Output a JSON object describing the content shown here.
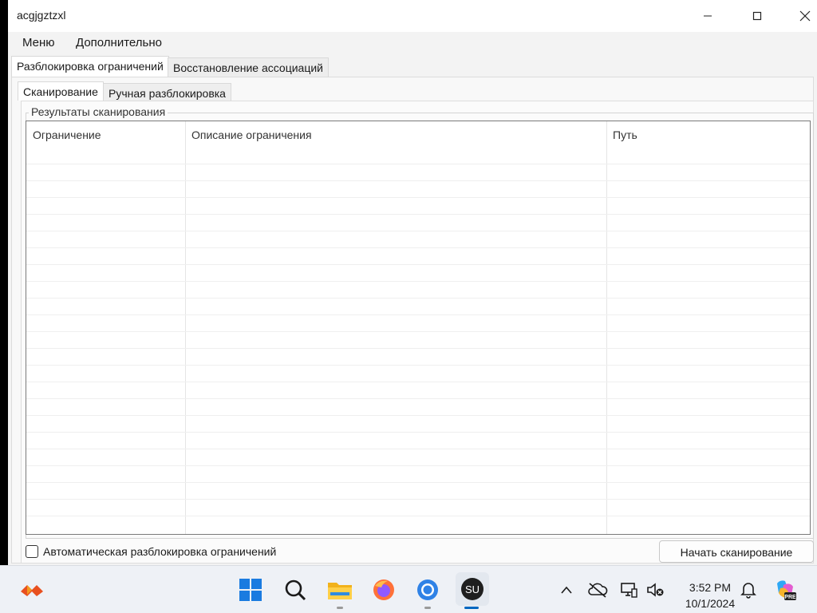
{
  "window": {
    "title": "acgjgztzxl"
  },
  "menu": {
    "items": [
      "Меню",
      "Дополнительно"
    ]
  },
  "tabs": {
    "outer": [
      "Разблокировка ограничений",
      "Восстановление ассоциаций"
    ],
    "inner": [
      "Сканирование",
      "Ручная разблокировка"
    ]
  },
  "scan": {
    "group_title": "Результаты сканирования",
    "columns": [
      "Ограничение",
      "Описание ограничения",
      "Путь"
    ],
    "auto_unlock_label": "Автоматическая разблокировка ограничений",
    "auto_unlock_checked": false,
    "start_button": "Начать сканирование"
  },
  "taskbar": {
    "icons": [
      "start-icon",
      "search-icon",
      "file-explorer-icon",
      "firefox-icon",
      "chrome-icon",
      "su-app-icon"
    ],
    "tray_icons": [
      "chevron-up-icon",
      "onedrive-offline-icon",
      "network-icon",
      "volume-muted-icon",
      "notification-bell-icon",
      "copilot-icon"
    ],
    "time": "3:52 PM",
    "date": "10/1/2024",
    "accent_color": "#0067c0"
  }
}
